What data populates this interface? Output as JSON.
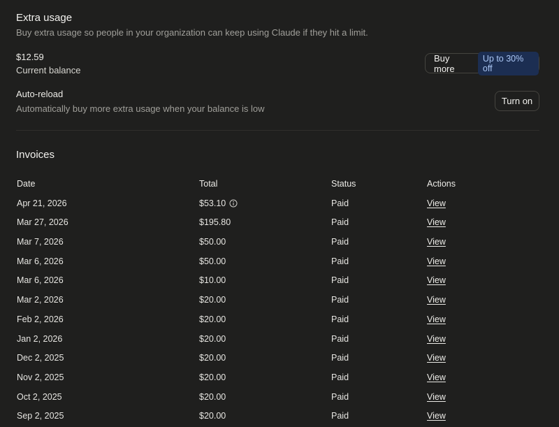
{
  "extra_usage": {
    "title": "Extra usage",
    "description": "Buy extra usage so people in your organization can keep using Claude if they hit a limit.",
    "balance_amount": "$12.59",
    "balance_label": "Current balance",
    "buy_more_label": "Buy more",
    "discount_badge": "Up to 30% off",
    "auto_reload_title": "Auto-reload",
    "auto_reload_description": "Automatically buy more extra usage when your balance is low",
    "turn_on_label": "Turn on"
  },
  "invoices": {
    "title": "Invoices",
    "columns": [
      "Date",
      "Total",
      "Status",
      "Actions"
    ],
    "rows": [
      {
        "date": "Apr 21, 2026",
        "total": "$53.10",
        "status": "Paid",
        "action": "View",
        "info_icon": true
      },
      {
        "date": "Mar 27, 2026",
        "total": "$195.80",
        "status": "Paid",
        "action": "View"
      },
      {
        "date": "Mar 7, 2026",
        "total": "$50.00",
        "status": "Paid",
        "action": "View"
      },
      {
        "date": "Mar 6, 2026",
        "total": "$50.00",
        "status": "Paid",
        "action": "View"
      },
      {
        "date": "Mar 6, 2026",
        "total": "$10.00",
        "status": "Paid",
        "action": "View"
      },
      {
        "date": "Mar 2, 2026",
        "total": "$20.00",
        "status": "Paid",
        "action": "View"
      },
      {
        "date": "Feb 2, 2026",
        "total": "$20.00",
        "status": "Paid",
        "action": "View"
      },
      {
        "date": "Jan 2, 2026",
        "total": "$20.00",
        "status": "Paid",
        "action": "View"
      },
      {
        "date": "Dec 2, 2025",
        "total": "$20.00",
        "status": "Paid",
        "action": "View"
      },
      {
        "date": "Nov 2, 2025",
        "total": "$20.00",
        "status": "Paid",
        "action": "View"
      },
      {
        "date": "Oct 2, 2025",
        "total": "$20.00",
        "status": "Paid",
        "action": "View"
      },
      {
        "date": "Sep 2, 2025",
        "total": "$20.00",
        "status": "Paid",
        "action": "View"
      }
    ]
  },
  "colors": {
    "background": "#1f1f1e",
    "badge_background": "#1c2e52",
    "badge_text": "#aac6f4"
  }
}
